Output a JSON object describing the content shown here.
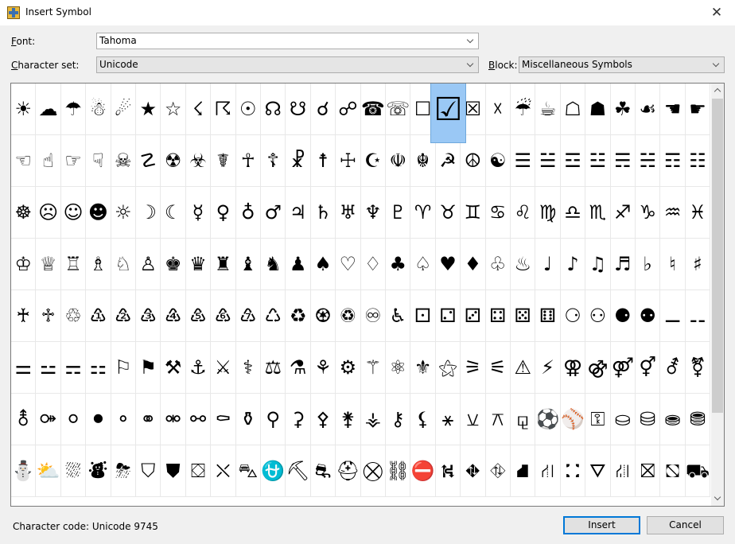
{
  "window": {
    "title": "Insert Symbol",
    "close_glyph": "✕"
  },
  "font": {
    "label_accel": "F",
    "label_rest": "ont:",
    "value": "Tahoma"
  },
  "charset": {
    "label_accel": "C",
    "label_rest": "haracter set:",
    "value": "Unicode"
  },
  "block": {
    "label_accel": "B",
    "label_rest": "lock:",
    "value": "Miscellaneous Symbols"
  },
  "symbols": [
    [
      "☀",
      "☁",
      "☂",
      "☃",
      "☄",
      "★",
      "☆",
      "☇",
      "☈",
      "☉",
      "☊",
      "☋",
      "☌",
      "☍",
      "☎",
      "☏",
      "☐",
      "☑",
      "☒",
      "☓",
      "☔",
      "☕",
      "☖",
      "☗",
      "☘",
      "☙",
      "☚",
      "☛"
    ],
    [
      "☜",
      "☝",
      "☞",
      "☟",
      "☠",
      "☡",
      "☢",
      "☣",
      "☤",
      "☥",
      "☦",
      "☧",
      "☨",
      "☩",
      "☪",
      "☫",
      "☬",
      "☭",
      "☮",
      "☯",
      "☰",
      "☱",
      "☲",
      "☳",
      "☴",
      "☵",
      "☶",
      "☷"
    ],
    [
      "☸",
      "☹",
      "☺",
      "☻",
      "☼",
      "☽",
      "☾",
      "☿",
      "♀",
      "♁",
      "♂",
      "♃",
      "♄",
      "♅",
      "♆",
      "♇",
      "♈",
      "♉",
      "♊",
      "♋",
      "♌",
      "♍",
      "♎",
      "♏",
      "♐",
      "♑",
      "♒",
      "♓"
    ],
    [
      "♔",
      "♕",
      "♖",
      "♗",
      "♘",
      "♙",
      "♚",
      "♛",
      "♜",
      "♝",
      "♞",
      "♟",
      "♠",
      "♡",
      "♢",
      "♣",
      "♤",
      "♥",
      "♦",
      "♧",
      "♨",
      "♩",
      "♪",
      "♫",
      "♬",
      "♭",
      "♮",
      "♯"
    ],
    [
      "♰",
      "♱",
      "♲",
      "♳",
      "♴",
      "♵",
      "♶",
      "♷",
      "♸",
      "♹",
      "♺",
      "♻",
      "♼",
      "♽",
      "♾",
      "♿",
      "⚀",
      "⚁",
      "⚂",
      "⚃",
      "⚄",
      "⚅",
      "⚆",
      "⚇",
      "⚈",
      "⚉",
      "⚊",
      "⚋"
    ],
    [
      "⚌",
      "⚍",
      "⚎",
      "⚏",
      "⚐",
      "⚑",
      "⚒",
      "⚓",
      "⚔",
      "⚕",
      "⚖",
      "⚗",
      "⚘",
      "⚙",
      "⚚",
      "⚛",
      "⚜",
      "⚝",
      "⚞",
      "⚟",
      "⚠",
      "⚡",
      "⚢",
      "⚣",
      "⚤",
      "⚥",
      "⚦",
      "⚧"
    ],
    [
      "⚨",
      "⚩",
      "⚪",
      "⚫",
      "⚬",
      "⚭",
      "⚮",
      "⚯",
      "⚰",
      "⚱",
      "⚲",
      "⚳",
      "⚴",
      "⚵",
      "⚶",
      "⚷",
      "⚸",
      "⚹",
      "⚺",
      "⚻",
      "⚼",
      "⚽",
      "⚾",
      "⚿",
      "⛀",
      "⛁",
      "⛂",
      "⛃"
    ],
    [
      "⛄",
      "⛅",
      "⛆",
      "⛇",
      "⛈",
      "⛉",
      "⛊",
      "⛋",
      "⛌",
      "⛍",
      "⛎",
      "⛏",
      "⛐",
      "⛑",
      "⛒",
      "⛓",
      "⛔",
      "⛕",
      "⛖",
      "⛗",
      "⛘",
      "⛙",
      "⛚",
      "⛛",
      "⛜",
      "⛝",
      "⛞",
      "⛟"
    ]
  ],
  "selected": {
    "row": 0,
    "col": 17
  },
  "status": {
    "text": "Character code: Unicode 9745"
  },
  "buttons": {
    "insert": "Insert",
    "cancel": "Cancel"
  },
  "colors": {
    "selection": "#9ac8f5",
    "default_button_border": "#0078d7"
  },
  "icons": {
    "app": "insert-symbol-app-icon",
    "close": "close-icon"
  }
}
